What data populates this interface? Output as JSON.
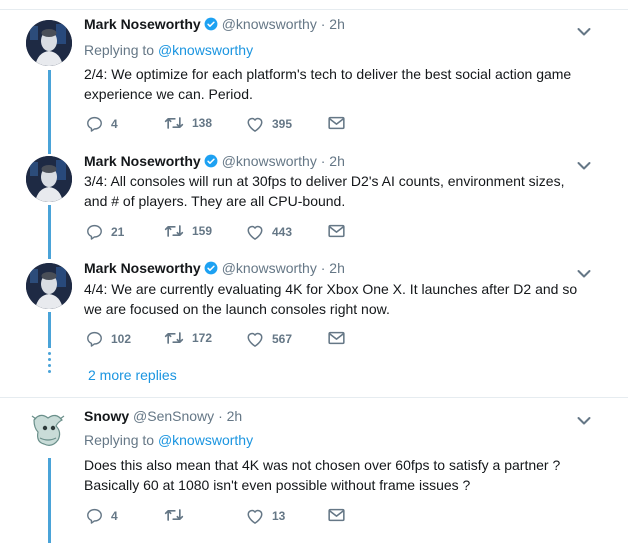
{
  "tweets": [
    {
      "name": "Mark Noseworthy",
      "handle": "@knowsworthy",
      "time": "2h",
      "replying_prefix": "Replying to",
      "replying_to": "@knowsworthy",
      "text": "2/4: We optimize for each platform's tech to deliver the best social action game experience we can. Period.",
      "replies": "4",
      "retweets": "138",
      "likes": "395"
    },
    {
      "name": "Mark Noseworthy",
      "handle": "@knowsworthy",
      "time": "2h",
      "text": "3/4: All consoles will run at 30fps to deliver D2's AI counts, environment sizes, and # of players. They are all CPU-bound.",
      "replies": "21",
      "retweets": "159",
      "likes": "443"
    },
    {
      "name": "Mark Noseworthy",
      "handle": "@knowsworthy",
      "time": "2h",
      "text": "4/4: We are currently evaluating 4K for Xbox One X. It launches after D2 and so we are focused on the launch consoles right now.",
      "replies": "102",
      "retweets": "172",
      "likes": "567"
    },
    {
      "name": "Snowy",
      "handle": "@SenSnowy",
      "time": "2h",
      "replying_prefix": "Replying to",
      "replying_to": "@knowsworthy",
      "text": "Does this also mean that 4K was not chosen over 60fps to satisfy a partner ? Basically 60 at 1080 isn't even possible without frame issues ?",
      "replies": "4",
      "retweets": "",
      "likes": "13"
    }
  ],
  "more_replies": "2 more replies",
  "separator": "·",
  "colors": {
    "accent": "#1b95e0",
    "thread": "#4aa3d8",
    "muted": "#657786"
  },
  "icons": [
    "verified-badge-icon",
    "chevron-down-icon",
    "reply-icon",
    "retweet-icon",
    "like-icon",
    "message-icon"
  ]
}
